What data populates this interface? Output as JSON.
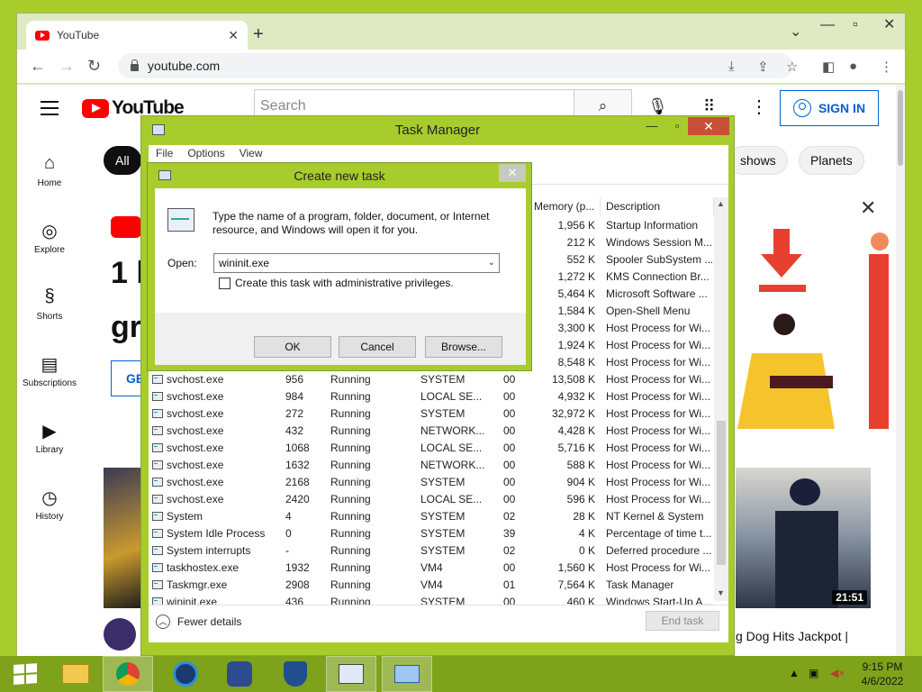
{
  "browser": {
    "tab_title": "YouTube",
    "tab_close": "✕",
    "new_tab": "+",
    "url": "youtube.com"
  },
  "youtube": {
    "logo_text": "YouTube",
    "search_placeholder": "Search",
    "sign_in": "SIGN IN",
    "sidebar": [
      {
        "label": "Home"
      },
      {
        "label": "Explore"
      },
      {
        "label": "Shorts"
      },
      {
        "label": "Subscriptions"
      },
      {
        "label": "Library"
      },
      {
        "label": "History"
      }
    ],
    "chips": [
      "All",
      "shows",
      "Planets"
    ],
    "hero_line1": "1 h",
    "hero_line2": "gr",
    "hero_button": "GE",
    "video_duration": "21:51",
    "video_title": "g Dog Hits Jackpot |"
  },
  "task_manager": {
    "title": "Task Manager",
    "menu": [
      "File",
      "Options",
      "View"
    ],
    "columns": {
      "memory": "Memory (p...",
      "description": "Description"
    },
    "rows_partial": [
      {
        "memory": "1,956 K",
        "description": "Startup Information"
      },
      {
        "memory": "212 K",
        "description": "Windows Session M..."
      },
      {
        "memory": "552 K",
        "description": "Spooler SubSystem ..."
      },
      {
        "memory": "1,272 K",
        "description": "KMS Connection Br..."
      },
      {
        "memory": "5,464 K",
        "description": "Microsoft Software ..."
      },
      {
        "memory": "1,584 K",
        "description": "Open-Shell Menu"
      },
      {
        "memory": "3,300 K",
        "description": "Host Process for Wi..."
      },
      {
        "memory": "1,924 K",
        "description": "Host Process for Wi..."
      },
      {
        "memory": "8,548 K",
        "description": "Host Process for Wi..."
      }
    ],
    "rows": [
      {
        "name": "svchost.exe",
        "pid": "956",
        "status": "Running",
        "user": "SYSTEM",
        "cpu": "00",
        "memory": "13,508 K",
        "description": "Host Process for Wi..."
      },
      {
        "name": "svchost.exe",
        "pid": "984",
        "status": "Running",
        "user": "LOCAL SE...",
        "cpu": "00",
        "memory": "4,932 K",
        "description": "Host Process for Wi..."
      },
      {
        "name": "svchost.exe",
        "pid": "272",
        "status": "Running",
        "user": "SYSTEM",
        "cpu": "00",
        "memory": "32,972 K",
        "description": "Host Process for Wi..."
      },
      {
        "name": "svchost.exe",
        "pid": "432",
        "status": "Running",
        "user": "NETWORK...",
        "cpu": "00",
        "memory": "4,428 K",
        "description": "Host Process for Wi..."
      },
      {
        "name": "svchost.exe",
        "pid": "1068",
        "status": "Running",
        "user": "LOCAL SE...",
        "cpu": "00",
        "memory": "5,716 K",
        "description": "Host Process for Wi..."
      },
      {
        "name": "svchost.exe",
        "pid": "1632",
        "status": "Running",
        "user": "NETWORK...",
        "cpu": "00",
        "memory": "588 K",
        "description": "Host Process for Wi..."
      },
      {
        "name": "svchost.exe",
        "pid": "2168",
        "status": "Running",
        "user": "SYSTEM",
        "cpu": "00",
        "memory": "904 K",
        "description": "Host Process for Wi..."
      },
      {
        "name": "svchost.exe",
        "pid": "2420",
        "status": "Running",
        "user": "LOCAL SE...",
        "cpu": "00",
        "memory": "596 K",
        "description": "Host Process for Wi..."
      },
      {
        "name": "System",
        "pid": "4",
        "status": "Running",
        "user": "SYSTEM",
        "cpu": "02",
        "memory": "28 K",
        "description": "NT Kernel & System"
      },
      {
        "name": "System Idle Process",
        "pid": "0",
        "status": "Running",
        "user": "SYSTEM",
        "cpu": "39",
        "memory": "4 K",
        "description": "Percentage of time t..."
      },
      {
        "name": "System interrupts",
        "pid": "-",
        "status": "Running",
        "user": "SYSTEM",
        "cpu": "02",
        "memory": "0 K",
        "description": "Deferred procedure ..."
      },
      {
        "name": "taskhostex.exe",
        "pid": "1932",
        "status": "Running",
        "user": "VM4",
        "cpu": "00",
        "memory": "1,560 K",
        "description": "Host Process for Wi..."
      },
      {
        "name": "Taskmgr.exe",
        "pid": "2908",
        "status": "Running",
        "user": "VM4",
        "cpu": "01",
        "memory": "7,564 K",
        "description": "Task Manager"
      },
      {
        "name": "wininit.exe",
        "pid": "436",
        "status": "Running",
        "user": "SYSTEM",
        "cpu": "00",
        "memory": "460 K",
        "description": "Windows Start-Up A..."
      }
    ],
    "fewer_details": "Fewer details",
    "end_task": "End task"
  },
  "dialog": {
    "title": "Create new task",
    "close": "✕",
    "description": "Type the name of a program, folder, document, or Internet resource, and Windows will open it for you.",
    "open_label": "Open:",
    "open_value": "wininit.exe",
    "admin_label": "Create this task with administrative privileges.",
    "ok": "OK",
    "cancel": "Cancel",
    "browse": "Browse..."
  },
  "taskbar": {
    "time": "9:15 PM",
    "date": "4/6/2022"
  }
}
